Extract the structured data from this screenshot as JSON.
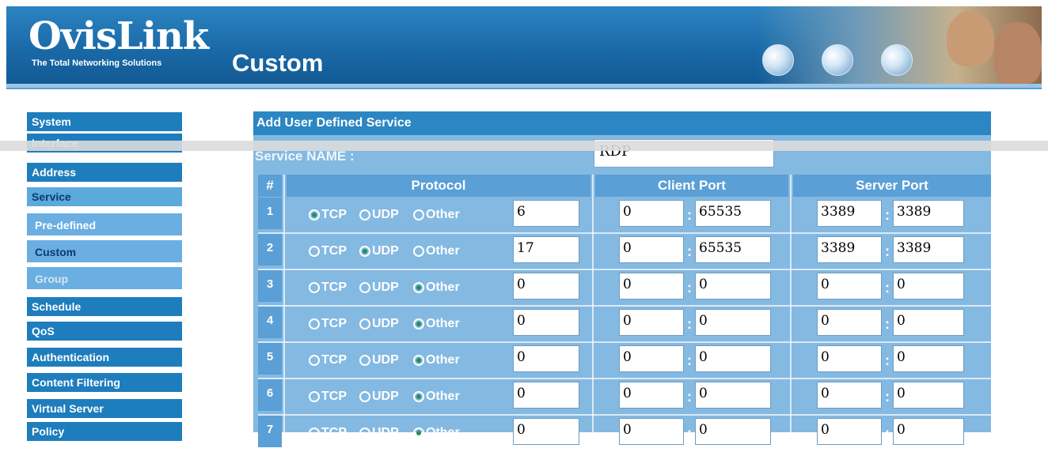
{
  "header": {
    "logo": "OvisLink",
    "tagline": "The Total Networking Solutions",
    "page_title": "Custom"
  },
  "sidebar": {
    "items": [
      {
        "label": "System"
      },
      {
        "label": "Interface"
      },
      {
        "label": "Address"
      },
      {
        "label": "Service"
      },
      {
        "label": "Schedule"
      },
      {
        "label": "QoS"
      },
      {
        "label": "Authentication"
      },
      {
        "label": "Content Filtering"
      },
      {
        "label": "Virtual Server"
      },
      {
        "label": "Policy"
      }
    ],
    "service_sub": [
      {
        "label": "Pre-defined"
      },
      {
        "label": "Custom"
      },
      {
        "label": "Group"
      }
    ]
  },
  "panel": {
    "title": "Add User Defined Service",
    "service_name_label": "Service NAME :",
    "service_name_value": "RDP",
    "columns": {
      "num": "#",
      "protocol": "Protocol",
      "client": "Client Port",
      "server": "Server Port"
    },
    "radio_labels": {
      "tcp": "TCP",
      "udp": "UDP",
      "other": "Other"
    },
    "rows": [
      {
        "num": "1",
        "selected": "TCP",
        "proto": "6",
        "c1": "0",
        "c2": "65535",
        "s1": "3389",
        "s2": "3389"
      },
      {
        "num": "2",
        "selected": "UDP",
        "proto": "17",
        "c1": "0",
        "c2": "65535",
        "s1": "3389",
        "s2": "3389"
      },
      {
        "num": "3",
        "selected": "Other",
        "proto": "0",
        "c1": "0",
        "c2": "0",
        "s1": "0",
        "s2": "0"
      },
      {
        "num": "4",
        "selected": "Other",
        "proto": "0",
        "c1": "0",
        "c2": "0",
        "s1": "0",
        "s2": "0"
      },
      {
        "num": "5",
        "selected": "Other",
        "proto": "0",
        "c1": "0",
        "c2": "0",
        "s1": "0",
        "s2": "0"
      },
      {
        "num": "6",
        "selected": "Other",
        "proto": "0",
        "c1": "0",
        "c2": "0",
        "s1": "0",
        "s2": "0"
      },
      {
        "num": "7",
        "selected": "Other",
        "proto": "0",
        "c1": "0",
        "c2": "0",
        "s1": "0",
        "s2": "0"
      }
    ]
  }
}
